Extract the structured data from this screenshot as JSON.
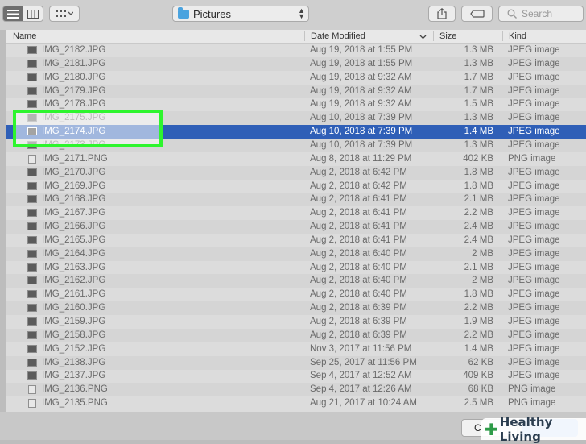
{
  "toolbar": {
    "location": "Pictures",
    "search_placeholder": "Search"
  },
  "columns": {
    "name": "Name",
    "date": "Date Modified",
    "size": "Size",
    "kind": "Kind"
  },
  "files": [
    {
      "name": "IMG_2182.JPG",
      "date": "Aug 19, 2018 at 1:55 PM",
      "size": "1.3 MB",
      "kind": "JPEG image"
    },
    {
      "name": "IMG_2181.JPG",
      "date": "Aug 19, 2018 at 1:55 PM",
      "size": "1.3 MB",
      "kind": "JPEG image"
    },
    {
      "name": "IMG_2180.JPG",
      "date": "Aug 19, 2018 at 9:32 AM",
      "size": "1.7 MB",
      "kind": "JPEG image"
    },
    {
      "name": "IMG_2179.JPG",
      "date": "Aug 19, 2018 at 9:32 AM",
      "size": "1.7 MB",
      "kind": "JPEG image"
    },
    {
      "name": "IMG_2178.JPG",
      "date": "Aug 19, 2018 at 9:32 AM",
      "size": "1.5 MB",
      "kind": "JPEG image"
    },
    {
      "name": "IMG_2175.JPG",
      "date": "Aug 10, 2018 at 7:39 PM",
      "size": "1.3 MB",
      "kind": "JPEG image"
    },
    {
      "name": "IMG_2174.JPG",
      "date": "Aug 10, 2018 at 7:39 PM",
      "size": "1.4 MB",
      "kind": "JPEG image"
    },
    {
      "name": "IMG_2173.JPG",
      "date": "Aug 10, 2018 at 7:39 PM",
      "size": "1.3 MB",
      "kind": "JPEG image"
    },
    {
      "name": "IMG_2171.PNG",
      "date": "Aug 8, 2018 at 11:29 PM",
      "size": "402 KB",
      "kind": "PNG image"
    },
    {
      "name": "IMG_2170.JPG",
      "date": "Aug 2, 2018 at 6:42 PM",
      "size": "1.8 MB",
      "kind": "JPEG image"
    },
    {
      "name": "IMG_2169.JPG",
      "date": "Aug 2, 2018 at 6:42 PM",
      "size": "1.8 MB",
      "kind": "JPEG image"
    },
    {
      "name": "IMG_2168.JPG",
      "date": "Aug 2, 2018 at 6:41 PM",
      "size": "2.1 MB",
      "kind": "JPEG image"
    },
    {
      "name": "IMG_2167.JPG",
      "date": "Aug 2, 2018 at 6:41 PM",
      "size": "2.2 MB",
      "kind": "JPEG image"
    },
    {
      "name": "IMG_2166.JPG",
      "date": "Aug 2, 2018 at 6:41 PM",
      "size": "2.4 MB",
      "kind": "JPEG image"
    },
    {
      "name": "IMG_2165.JPG",
      "date": "Aug 2, 2018 at 6:41 PM",
      "size": "2.4 MB",
      "kind": "JPEG image"
    },
    {
      "name": "IMG_2164.JPG",
      "date": "Aug 2, 2018 at 6:40 PM",
      "size": "2 MB",
      "kind": "JPEG image"
    },
    {
      "name": "IMG_2163.JPG",
      "date": "Aug 2, 2018 at 6:40 PM",
      "size": "2.1 MB",
      "kind": "JPEG image"
    },
    {
      "name": "IMG_2162.JPG",
      "date": "Aug 2, 2018 at 6:40 PM",
      "size": "2 MB",
      "kind": "JPEG image"
    },
    {
      "name": "IMG_2161.JPG",
      "date": "Aug 2, 2018 at 6:40 PM",
      "size": "1.8 MB",
      "kind": "JPEG image"
    },
    {
      "name": "IMG_2160.JPG",
      "date": "Aug 2, 2018 at 6:39 PM",
      "size": "2.2 MB",
      "kind": "JPEG image"
    },
    {
      "name": "IMG_2159.JPG",
      "date": "Aug 2, 2018 at 6:39 PM",
      "size": "1.9 MB",
      "kind": "JPEG image"
    },
    {
      "name": "IMG_2158.JPG",
      "date": "Aug 2, 2018 at 6:39 PM",
      "size": "2.2 MB",
      "kind": "JPEG image"
    },
    {
      "name": "IMG_2152.JPG",
      "date": "Nov 3, 2017 at 11:56 PM",
      "size": "1.4 MB",
      "kind": "JPEG image"
    },
    {
      "name": "IMG_2138.JPG",
      "date": "Sep 25, 2017 at 11:56 PM",
      "size": "62 KB",
      "kind": "JPEG image"
    },
    {
      "name": "IMG_2137.JPG",
      "date": "Sep 4, 2017 at 12:52 AM",
      "size": "409 KB",
      "kind": "JPEG image"
    },
    {
      "name": "IMG_2136.PNG",
      "date": "Sep 4, 2017 at 12:26 AM",
      "size": "68 KB",
      "kind": "PNG image"
    },
    {
      "name": "IMG_2135.PNG",
      "date": "Aug 21, 2017 at 10:24 AM",
      "size": "2.5 MB",
      "kind": "PNG image"
    }
  ],
  "selected_index": 6,
  "footer": {
    "cancel_label": "C",
    "watermark": "Healthy Living"
  },
  "colors": {
    "selection": "#2f5fb7",
    "highlight": "#2ef52e"
  }
}
